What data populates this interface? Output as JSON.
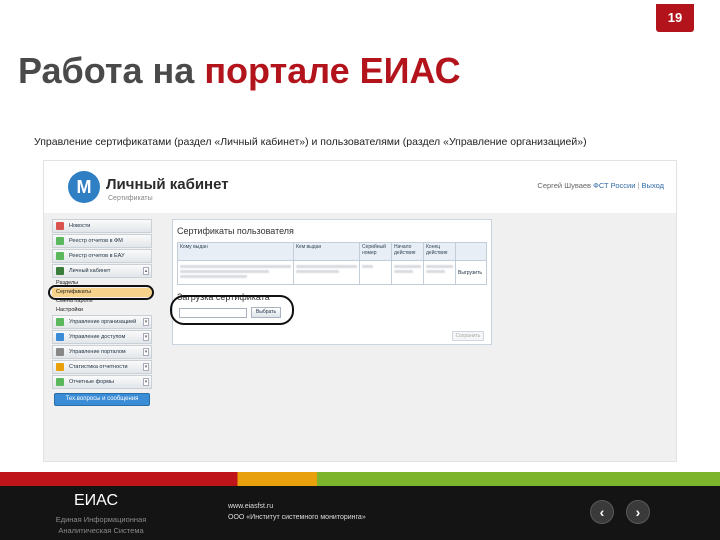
{
  "page_number": "19",
  "title": {
    "part1": "Работа на ",
    "part2": "портале ЕИАС"
  },
  "subtitle": "Управление сертификатами (раздел «Личный кабинет») и пользователями (раздел «Управление организацией»)",
  "portal": {
    "logo_letter": "М",
    "title": "Личный кабинет",
    "subtitle": "Сертификаты",
    "user_name": "Сергей Шуваев",
    "org": "ФСТ России",
    "separator": "|",
    "exit": "Выход"
  },
  "sidebar": {
    "items": [
      {
        "label": "Новости",
        "color": "#d9534f"
      },
      {
        "label": "Реестр отчетов в ФМ",
        "color": "#5cb85c"
      },
      {
        "label": "Реестр отчетов в ЕАУ",
        "color": "#5cb85c"
      },
      {
        "label": "Личный кабинет",
        "color": "#3a7d3a"
      }
    ],
    "subitems": [
      "Разделы",
      "Сертификаты",
      "Смена пароля",
      "Настройки"
    ],
    "items2": [
      {
        "label": "Управление организацией",
        "color": "#5cb85c"
      },
      {
        "label": "Управление доступом",
        "color": "#3a8cd6"
      },
      {
        "label": "Управление порталом",
        "color": "#888888"
      },
      {
        "label": "Статистика отчетности",
        "color": "#e8a10d"
      },
      {
        "label": "Отчетные формы",
        "color": "#5cb85c"
      }
    ],
    "search_button": "Тех.вопросы и сообщения"
  },
  "content": {
    "certs_title": "Сертификаты пользователя",
    "columns": [
      "Кому выдан",
      "Кем выдан",
      "Серийный номер",
      "Начало действия",
      "Конец действия",
      ""
    ],
    "row_action": "Выгрузить",
    "upload_title": "Загрузка сертификата",
    "upload_button": "Выбрать",
    "disabled_button": "Сохранить"
  },
  "footer": {
    "brand": "ЕИАС",
    "brand_sub1": "Единая Информационная",
    "brand_sub2": "Аналитическая Система",
    "site": "www.eiasfst.ru",
    "org": "ООО «Институт системного мониторинга»",
    "prev": "‹",
    "next": "›"
  }
}
